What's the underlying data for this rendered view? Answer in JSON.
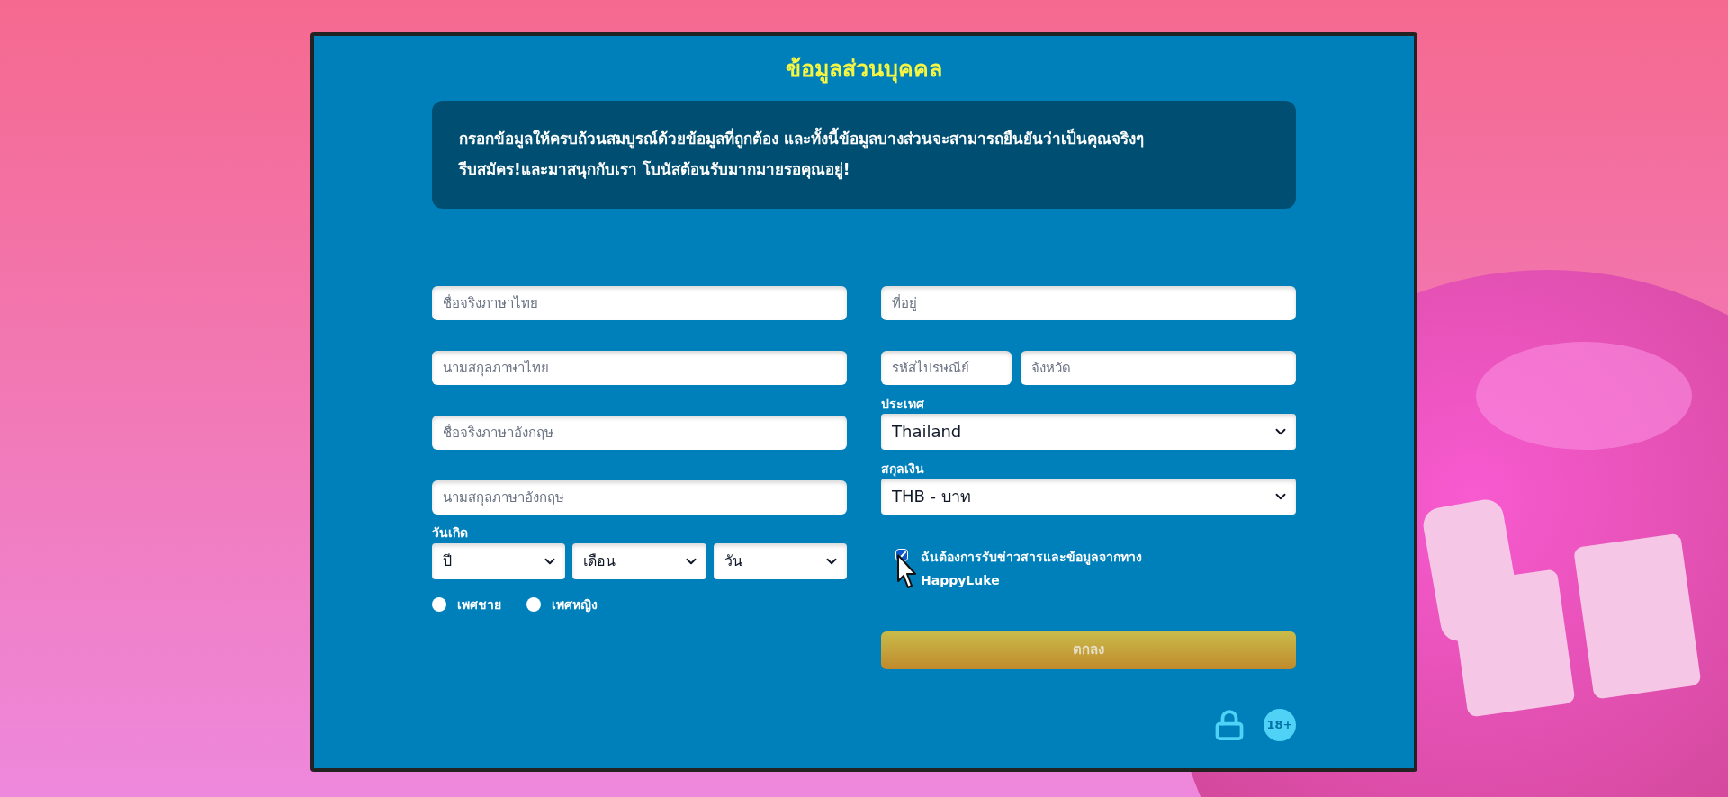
{
  "title": "ข้อมูลส่วนบุคคล",
  "notice_lines": [
    "กรอกข้อมูลให้ครบถ้วนสมบูรณ์ด้วยข้อมูลที่ถูกต้อง และทั้งนี้ข้อมูลบางส่วนจะสามารถยืนยันว่าเป็นคุณจริงๆ",
    "รีบสมัคร!และมาสนุกกับเรา โบนัสต้อนรับมากมายรอคุณอยู่!"
  ],
  "name_fields": [
    {
      "placeholder": "ชื่อจริงภาษาไทย"
    },
    {
      "placeholder": "นามสกุลภาษาไทย"
    },
    {
      "placeholder": "ชื่อจริงภาษาอังกฤษ"
    },
    {
      "placeholder": "นามสกุลภาษาอังกฤษ"
    }
  ],
  "birthdate": {
    "label": "วันเกิด",
    "selects": [
      {
        "value": "ปี"
      },
      {
        "value": "เดือน"
      },
      {
        "value": "วัน"
      }
    ]
  },
  "gender": [
    {
      "label": "เพศชาย",
      "selected": false
    },
    {
      "label": "เพศหญิง",
      "selected": false
    }
  ],
  "address": {
    "placeholder": "ที่อยู่"
  },
  "postcode": {
    "placeholder": "รหัสไปรษณีย์"
  },
  "province": {
    "placeholder": "จังหวัด"
  },
  "country": {
    "label": "ประเทศ",
    "value": "Thailand"
  },
  "currency": {
    "label": "สกุลเงิน",
    "value": "THB - บาท"
  },
  "newsletter": {
    "label": "ฉันต้องการรับข่าวสารและข้อมูลจากทาง HappyLuke",
    "checked": true
  },
  "submit": {
    "label": "ตกลง"
  },
  "age_badge": "18+"
}
